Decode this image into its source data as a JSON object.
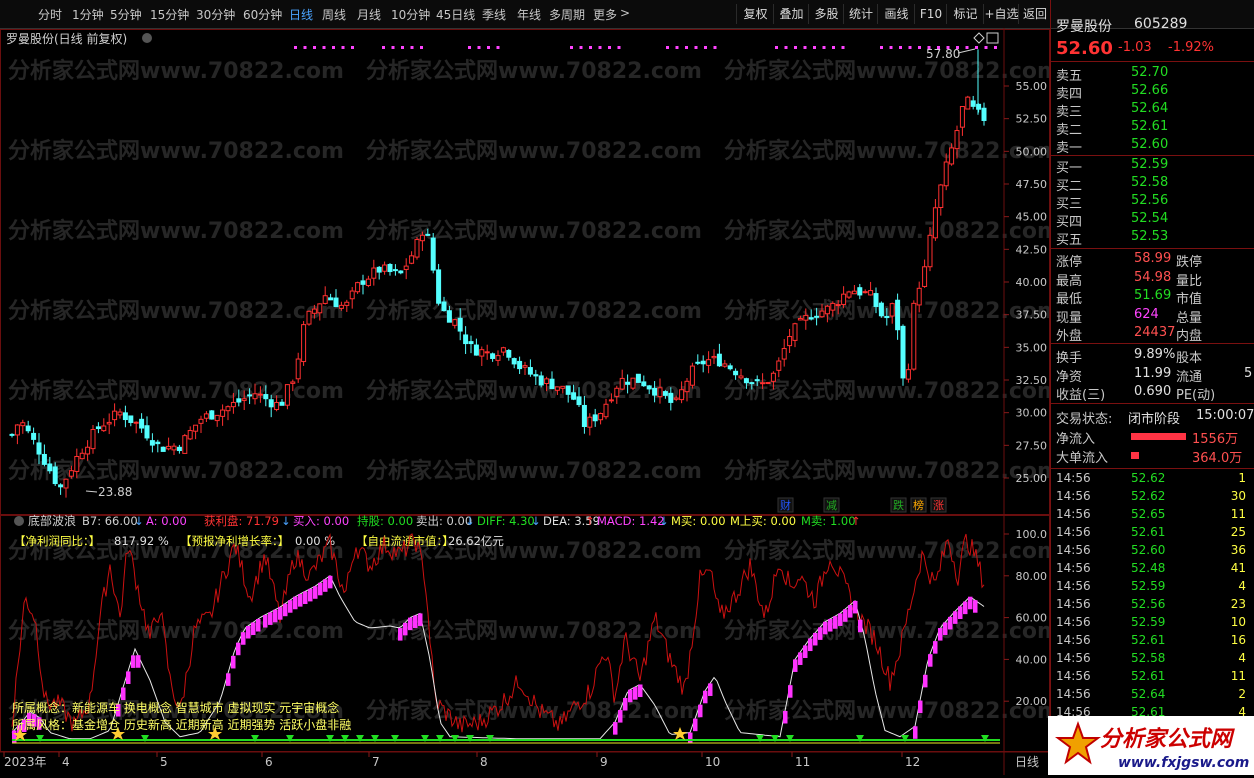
{
  "toolbar": {
    "periods": [
      "分时",
      "1分钟",
      "5分钟",
      "15分钟",
      "30分钟",
      "60分钟",
      "日线",
      "周线",
      "月线",
      "10分钟",
      "45日线",
      "季线",
      "年线",
      "多周期",
      "更多"
    ],
    "active_period": "日线",
    "more_arrow": ">",
    "buttons": [
      "复权",
      "叠加",
      "多股",
      "统计",
      "画线",
      "F10",
      "标记",
      "+自选",
      "返回"
    ]
  },
  "chart": {
    "title": "罗曼股份(日线 前复权)",
    "high_marker": "57.80",
    "low_marker": "23.88",
    "y_ticks": [
      "55.00",
      "52.50",
      "50.00",
      "47.50",
      "45.00",
      "42.50",
      "40.00",
      "37.50",
      "35.00",
      "32.50",
      "30.00",
      "27.50",
      "25.00"
    ],
    "event_tags": [
      {
        "text": "财",
        "color": "#2255ff"
      },
      {
        "text": "减",
        "color": "#22aa22"
      },
      {
        "text": "跌",
        "color": "#22aa22"
      },
      {
        "text": "榜",
        "color": "#ffaa00"
      },
      {
        "text": "涨",
        "color": "#ff3333"
      }
    ]
  },
  "indicator": {
    "name": "底部波浪",
    "values": [
      {
        "text": "B7: 66.00",
        "color": "#d0d0d0",
        "arrow": "↓"
      },
      {
        "text": "A: 0.00",
        "color": "#ff44ff"
      },
      {
        "text": "获利盘: 71.79",
        "color": "#ff3333",
        "arrow": "↓"
      },
      {
        "text": "买入: 0.00",
        "color": "#ff44ff"
      },
      {
        "text": "持股: 0.00",
        "color": "#22dd22"
      },
      {
        "text": "卖出: 0.00",
        "color": "#d0d0d0",
        "arrow": "↓"
      },
      {
        "text": "DIFF: 4.30",
        "color": "#22dd22",
        "arrow": "↓"
      },
      {
        "text": "DEA: 3.59",
        "color": "#e0e0e0",
        "arrow": "↑"
      },
      {
        "text": "MACD: 1.42",
        "color": "#ff44ff",
        "arrow": "↓"
      },
      {
        "text": "M买: 0.00",
        "color": "#ffff44"
      },
      {
        "text": "M上买: 0.00",
        "color": "#ffff44"
      },
      {
        "text": "M卖: 1.00",
        "color": "#22dd22",
        "arrow": "↑"
      }
    ],
    "info_line": [
      {
        "label": "【净利润同比：】",
        "value": "817.92 %"
      },
      {
        "label": "【预报净利增长率：】",
        "value": "0.00 %"
      },
      {
        "label": "【自由流通市值：】",
        "value": "26.62亿元"
      }
    ],
    "y_ticks": [
      "100.0",
      "80.00",
      "60.00",
      "40.00",
      "20.00"
    ],
    "concepts": "所属概念：新能源车 换电概念 智慧城市 虚拟现实 元宇宙概念",
    "styles": "所属风格：基金增仓 历史新高 近期新高 近期强势 活跃小盘非融"
  },
  "xaxis": {
    "labels": [
      "2023年",
      "4",
      "5",
      "6",
      "7",
      "8",
      "9",
      "10",
      "11",
      "12"
    ],
    "period_label": "日线"
  },
  "quote": {
    "name": "罗曼股份",
    "code": "605289",
    "price": "52.60",
    "change": "-1.03",
    "change_pct": "-1.92%",
    "asks": [
      {
        "label": "卖五",
        "price": "52.70"
      },
      {
        "label": "卖四",
        "price": "52.66"
      },
      {
        "label": "卖三",
        "price": "52.64"
      },
      {
        "label": "卖二",
        "price": "52.61"
      },
      {
        "label": "卖一",
        "price": "52.60"
      }
    ],
    "bids": [
      {
        "label": "买一",
        "price": "52.59"
      },
      {
        "label": "买二",
        "price": "52.58"
      },
      {
        "label": "买三",
        "price": "52.56"
      },
      {
        "label": "买四",
        "price": "52.54"
      },
      {
        "label": "买五",
        "price": "52.53"
      }
    ],
    "stats": [
      {
        "l1": "涨停",
        "v1": "58.99",
        "c1": "red",
        "l2": "跌停"
      },
      {
        "l1": "最高",
        "v1": "54.98",
        "c1": "red",
        "l2": "量比"
      },
      {
        "l1": "最低",
        "v1": "51.69",
        "c1": "green",
        "l2": "市值"
      },
      {
        "l1": "现量",
        "v1": "624",
        "c1": "magenta",
        "l2": "总量"
      },
      {
        "l1": "外盘",
        "v1": "24437",
        "c1": "red",
        "l2": "内盘"
      }
    ],
    "stats2": [
      {
        "l1": "换手",
        "v1": "9.89%",
        "l2": "股本"
      },
      {
        "l1": "净资",
        "v1": "11.99",
        "l2": "流通",
        "v2": "5"
      },
      {
        "l1": "收益(三)",
        "v1": "0.690",
        "l2": "PE(动)"
      }
    ],
    "trade_status_label": "交易状态:",
    "trade_status": "闭市阶段",
    "trade_time": "15:00:07",
    "net_inflow_label": "净流入",
    "net_inflow": "1556万",
    "big_inflow_label": "大单流入",
    "big_inflow": "364.0万",
    "ticks": [
      {
        "time": "14:56",
        "price": "52.62",
        "vol": "1",
        "color": "yellow"
      },
      {
        "time": "14:56",
        "price": "52.62",
        "vol": "30",
        "color": "yellow"
      },
      {
        "time": "14:56",
        "price": "52.65",
        "vol": "11",
        "color": "yellow"
      },
      {
        "time": "14:56",
        "price": "52.61",
        "vol": "25",
        "color": "yellow"
      },
      {
        "time": "14:56",
        "price": "52.60",
        "vol": "36",
        "color": "yellow"
      },
      {
        "time": "14:56",
        "price": "52.48",
        "vol": "41",
        "color": "yellow"
      },
      {
        "time": "14:56",
        "price": "52.59",
        "vol": "4",
        "color": "yellow"
      },
      {
        "time": "14:56",
        "price": "52.56",
        "vol": "23",
        "color": "yellow"
      },
      {
        "time": "14:56",
        "price": "52.59",
        "vol": "10",
        "color": "yellow"
      },
      {
        "time": "14:56",
        "price": "52.61",
        "vol": "16",
        "color": "yellow"
      },
      {
        "time": "14:56",
        "price": "52.58",
        "vol": "4",
        "color": "yellow"
      },
      {
        "time": "14:56",
        "price": "52.61",
        "vol": "11",
        "color": "yellow"
      },
      {
        "time": "14:56",
        "price": "52.64",
        "vol": "2",
        "color": "yellow"
      },
      {
        "time": "14:56",
        "price": "52.61",
        "vol": "4",
        "color": "yellow"
      }
    ]
  },
  "watermark": "分析家公式网www.70822.com",
  "logo": {
    "main": "分析家公式网",
    "url": "www.fxjgsw.com"
  }
}
